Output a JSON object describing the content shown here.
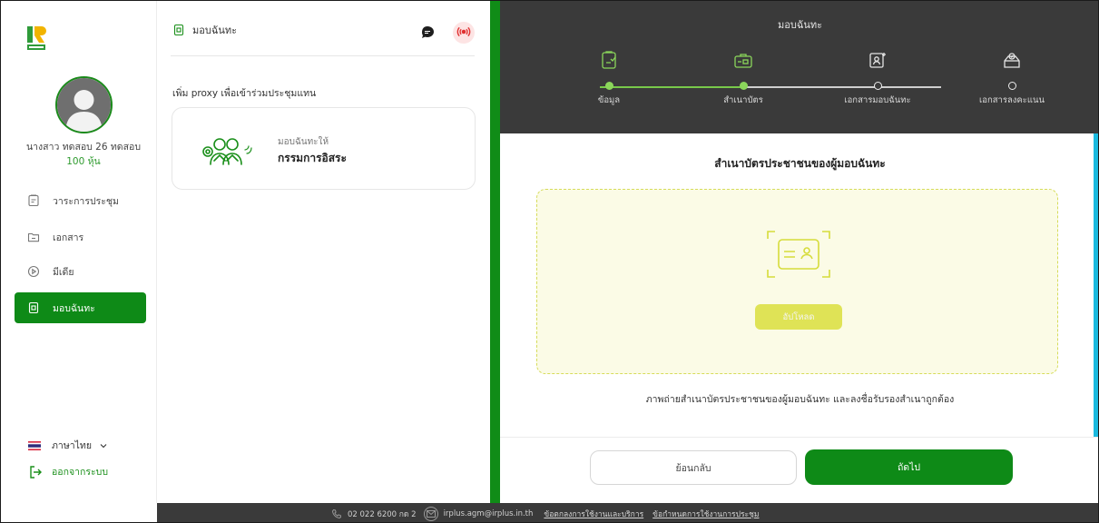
{
  "sidebar": {
    "user_name": "นางสาว ทดสอบ 26 ทดสอบ",
    "user_shares": "100 หุ้น",
    "nav": [
      {
        "label": "วาระการประชุม",
        "icon": "agenda-icon"
      },
      {
        "label": "เอกสาร",
        "icon": "folder-icon"
      },
      {
        "label": "มีเดีย",
        "icon": "play-icon"
      },
      {
        "label": "มอบฉันทะ",
        "icon": "proxy-doc-icon",
        "active": true
      }
    ],
    "language": "ภาษาไทย",
    "logout": "ออกจากระบบ"
  },
  "middle": {
    "header": "มอบฉันทะ",
    "proxy_title": "เพิ่ม proxy เพื่อเข้าร่วมประชุมแทน",
    "card": {
      "subtitle": "มอบฉันทะให้",
      "title": "กรรมการอิสระ"
    }
  },
  "wizard": {
    "title": "มอบฉันทะ",
    "steps": [
      {
        "label": "ข้อมูล",
        "status": "done",
        "icon": "clipboard-icon"
      },
      {
        "label": "สำเนาบัตร",
        "status": "done",
        "icon": "id-card-icon"
      },
      {
        "label": "เอกสารมอบฉันทะ",
        "status": "todo",
        "icon": "proxy-form-icon"
      },
      {
        "label": "เอกสารลงคะแนน",
        "status": "todo",
        "icon": "vote-box-icon"
      }
    ],
    "body_title": "สำเนาบัตรประชาชนของผู้มอบฉันทะ",
    "upload_label": "อัปโหลด",
    "note": "ภาพถ่ายสำเนาบัตรประชาชนของผู้มอบฉันทะ และลงชื่อรับรองสำเนาถูกต้อง",
    "back_label": "ย้อนกลับ",
    "next_label": "ถัดไป"
  },
  "footer": {
    "phone": "02 022 6200 กด 2",
    "email": "irplus.agm@irplus.in.th",
    "terms_link": "ข้อตกลงการใช้งานและบริการ",
    "rules_link": "ข้อกำหนดการใช้งานการประชุม"
  },
  "colors": {
    "brand_green": "#0e8a17",
    "step_done": "#8bd65b",
    "upload_yellow": "#dfe356",
    "header_dark": "#3a3a3a"
  }
}
